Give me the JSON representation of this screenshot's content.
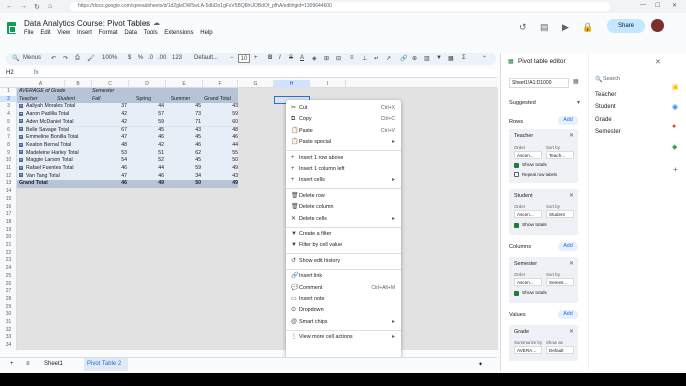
{
  "browser": {
    "url": "https://docs.google.com/spreadsheets/d/1d2gIeDW5wLA-5dbDo1gFsV5BQ8hUOBdOf_pfhA/edit#gid=1309644600"
  },
  "doc": {
    "title": "Data Analytics Course: Pivot Tables"
  },
  "menu": [
    "File",
    "Edit",
    "View",
    "Insert",
    "Format",
    "Data",
    "Tools",
    "Extensions",
    "Help"
  ],
  "toolbar": {
    "search": "Menus",
    "font": "Default...",
    "font_size": "10"
  },
  "header": {
    "share_label": "Share"
  },
  "formula": {
    "cell_ref": "H2"
  },
  "columns": [
    "A",
    "B",
    "C",
    "D",
    "E",
    "F",
    "G",
    "H",
    "I"
  ],
  "rows": [
    "1",
    "2",
    "3",
    "4",
    "5",
    "6",
    "7",
    "8",
    "9",
    "10",
    "11",
    "12",
    "13",
    "14",
    "15",
    "16",
    "17",
    "18",
    "19",
    "20",
    "21",
    "22",
    "23",
    "24",
    "25",
    "26",
    "27",
    "28",
    "29",
    "30",
    "31",
    "32",
    "33",
    "34"
  ],
  "pivot": {
    "r1": {
      "a": "AVERAGE of Grade",
      "c": "Semester"
    },
    "r2": {
      "a": "Teacher",
      "b": "Student",
      "c": "Fall",
      "d": "Spring",
      "e": "Summer",
      "f": "Grand Total"
    },
    "body": [
      {
        "name": "Aaliyah Morales Total",
        "v": [
          "37",
          "44",
          "45",
          "43"
        ]
      },
      {
        "name": "Aaron Padilla Total",
        "v": [
          "42",
          "57",
          "73",
          "59"
        ]
      },
      {
        "name": "Aden McDaniel Total",
        "v": [
          "42",
          "59",
          "71",
          "60"
        ]
      },
      {
        "name": "Belle Savage Total",
        "v": [
          "67",
          "45",
          "43",
          "48"
        ]
      },
      {
        "name": "Emmeline Bonilla Total",
        "v": [
          "47",
          "46",
          "45",
          "46"
        ]
      },
      {
        "name": "Keaton Bernal Total",
        "v": [
          "48",
          "42",
          "46",
          "44"
        ]
      },
      {
        "name": "Madeleine Harley Total",
        "v": [
          "53",
          "51",
          "62",
          "55"
        ]
      },
      {
        "name": "Maggie Larson Total",
        "v": [
          "54",
          "52",
          "45",
          "50"
        ]
      },
      {
        "name": "Rafael Fuentes Total",
        "v": [
          "46",
          "44",
          "59",
          "49"
        ]
      },
      {
        "name": "Van Tang Total",
        "v": [
          "47",
          "46",
          "34",
          "43"
        ]
      }
    ],
    "total": {
      "name": "Grand Total",
      "v": [
        "46",
        "49",
        "50",
        "49"
      ]
    }
  },
  "context_menu": [
    {
      "icon": "✂",
      "label": "Cut",
      "shortcut": "Ctrl+X"
    },
    {
      "icon": "⧉",
      "label": "Copy",
      "shortcut": "Ctrl+C"
    },
    {
      "icon": "📋",
      "label": "Paste",
      "shortcut": "Ctrl+V"
    },
    {
      "icon": "📋",
      "label": "Paste special",
      "arrow": "▸"
    },
    {
      "sep": true
    },
    {
      "icon": "+",
      "label": "Insert 1 row above"
    },
    {
      "icon": "+",
      "label": "Insert 1 column left"
    },
    {
      "icon": "+",
      "label": "Insert cells",
      "arrow": "▸"
    },
    {
      "sep": true
    },
    {
      "icon": "🗑",
      "label": "Delete row"
    },
    {
      "icon": "🗑",
      "label": "Delete column"
    },
    {
      "icon": "✕",
      "label": "Delete cells",
      "arrow": "▸"
    },
    {
      "sep": true
    },
    {
      "icon": "▼",
      "label": "Create a filter"
    },
    {
      "icon": "▼",
      "label": "Filter by cell value"
    },
    {
      "sep": true
    },
    {
      "icon": "↺",
      "label": "Show edit history"
    },
    {
      "sep": true
    },
    {
      "icon": "🔗",
      "label": "Insert link"
    },
    {
      "icon": "💬",
      "label": "Comment",
      "shortcut": "Ctrl+Alt+M"
    },
    {
      "icon": "▭",
      "label": "Insert note"
    },
    {
      "icon": "⊙",
      "label": "Dropdown"
    },
    {
      "icon": "@",
      "label": "Smart chips",
      "arrow": "▸"
    },
    {
      "sep": true
    },
    {
      "icon": "⋮",
      "label": "View more cell actions",
      "arrow": "▸"
    }
  ],
  "sheets": {
    "add": "+",
    "list": "≡",
    "s1": "Sheet1",
    "s2": "Pivot Table 2"
  },
  "editor": {
    "title": "Pivot table editor",
    "range": "Sheet1!A1:D1000",
    "suggested": "Suggested",
    "rows_label": "Rows",
    "columns_label": "Columns",
    "values_label": "Values",
    "add": "Add",
    "teacher": {
      "name": "Teacher",
      "order_lbl": "Order",
      "sort_lbl": "Sort by",
      "order": "Ascen...",
      "sort": "Teach...",
      "show_totals": "Show totals",
      "repeat": "Repeat row labels"
    },
    "student": {
      "name": "Student",
      "order_lbl": "Order",
      "sort_lbl": "Sort by",
      "order": "Ascen...",
      "sort": "Student",
      "show_totals": "Show totals"
    },
    "semester": {
      "name": "Semester",
      "order_lbl": "Order",
      "sort_lbl": "Sort by",
      "order": "Ascen...",
      "sort": "Semes...",
      "show_totals": "Show totals"
    },
    "grade": {
      "name": "Grade",
      "sum_lbl": "Summarize by",
      "show_lbl": "Show as",
      "sum": "AVERA...",
      "show": "Default"
    }
  },
  "fields": {
    "search": "Search",
    "items": [
      "Teacher",
      "Student",
      "Grade",
      "Semester"
    ]
  }
}
